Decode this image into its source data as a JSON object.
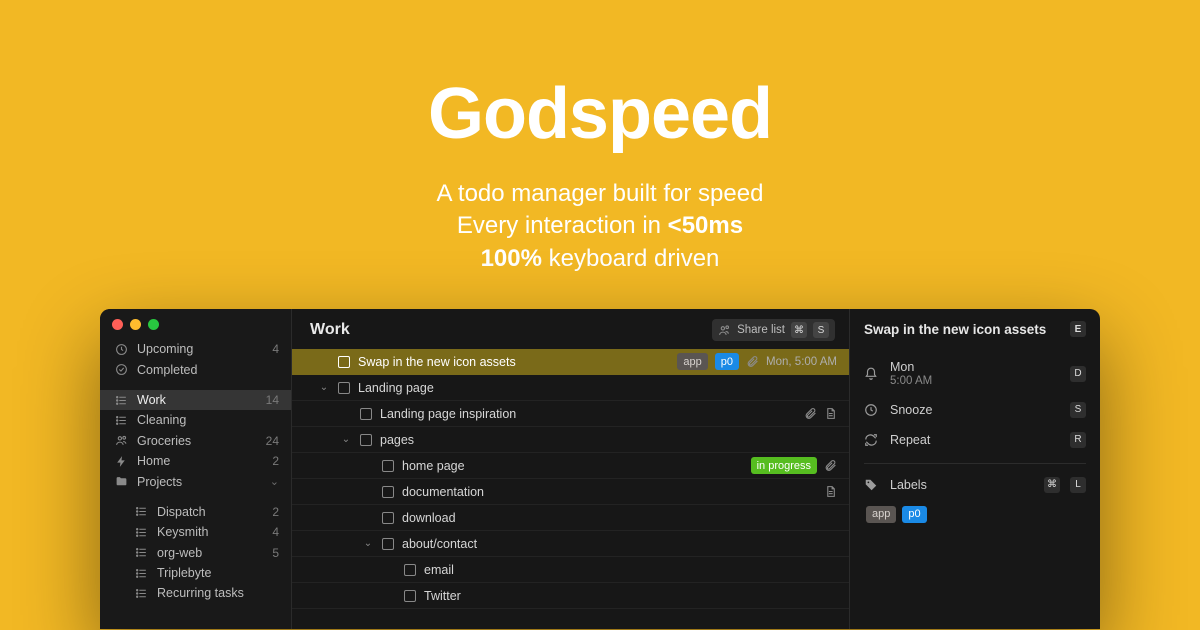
{
  "hero": {
    "title": "Godspeed",
    "tag1": "A todo manager built for speed",
    "tag2a": "Every interaction in ",
    "tag2b": "<50ms",
    "tag3a": "100%",
    "tag3b": " keyboard driven"
  },
  "sidebar": {
    "top": [
      {
        "icon": "clock",
        "label": "Upcoming",
        "count": "4"
      },
      {
        "icon": "check",
        "label": "Completed",
        "count": ""
      }
    ],
    "lists": [
      {
        "icon": "list",
        "label": "Work",
        "count": "14",
        "active": true
      },
      {
        "icon": "list",
        "label": "Cleaning",
        "count": ""
      },
      {
        "icon": "people",
        "label": "Groceries",
        "count": "24"
      },
      {
        "icon": "bolt",
        "label": "Home",
        "count": "2"
      },
      {
        "icon": "folder",
        "label": "Projects",
        "count": "",
        "expandable": true
      }
    ],
    "projects": [
      {
        "label": "Dispatch",
        "count": "2"
      },
      {
        "label": "Keysmith",
        "count": "4"
      },
      {
        "label": "org-web",
        "count": "5"
      },
      {
        "label": "Triplebyte",
        "count": ""
      },
      {
        "label": "Recurring tasks",
        "count": ""
      }
    ]
  },
  "main": {
    "title": "Work",
    "share_label": "Share list",
    "share_k1": "⌘",
    "share_k2": "S",
    "tasks": [
      {
        "depth": 0,
        "disclose": "",
        "title": "Swap in the new icon assets",
        "selected": true,
        "pills": [
          "app",
          "p0"
        ],
        "clip": true,
        "due": "Mon, 5:00 AM"
      },
      {
        "depth": 0,
        "disclose": "v",
        "title": "Landing page"
      },
      {
        "depth": 1,
        "disclose": "",
        "title": "Landing page inspiration",
        "clip": true,
        "doc": true
      },
      {
        "depth": 1,
        "disclose": "v",
        "title": "pages"
      },
      {
        "depth": 2,
        "disclose": "",
        "title": "home page",
        "pills": [
          "in progress"
        ],
        "clip": true
      },
      {
        "depth": 2,
        "disclose": "",
        "title": "documentation",
        "doc": true
      },
      {
        "depth": 2,
        "disclose": "",
        "title": "download"
      },
      {
        "depth": 2,
        "disclose": "v",
        "title": "about/contact"
      },
      {
        "depth": 3,
        "disclose": "",
        "title": "email"
      },
      {
        "depth": 3,
        "disclose": "",
        "title": "Twitter"
      }
    ]
  },
  "details": {
    "title": "Swap in the new icon assets",
    "title_k": "E",
    "date_top": "Mon",
    "date_sub": "5:00 AM",
    "date_k": "D",
    "snooze": "Snooze",
    "snooze_k": "S",
    "repeat": "Repeat",
    "repeat_k": "R",
    "labels_heading": "Labels",
    "labels_k1": "⌘",
    "labels_k2": "L",
    "labels": [
      "app",
      "p0"
    ]
  }
}
